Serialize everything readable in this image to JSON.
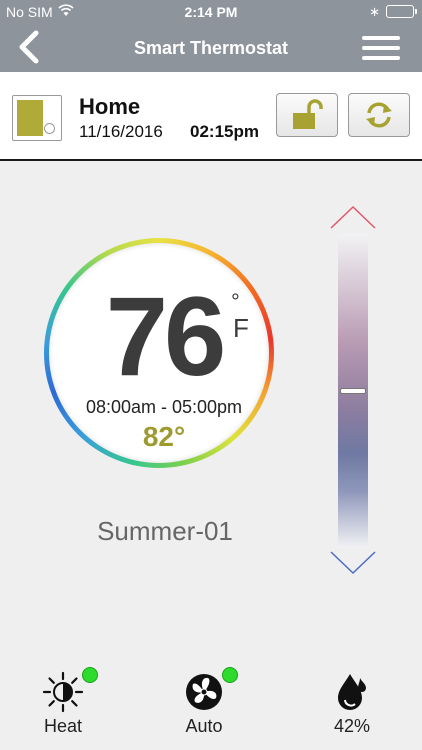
{
  "status_bar": {
    "carrier": "No SIM",
    "time": "2:14 PM"
  },
  "nav": {
    "title": "Smart Thermostat"
  },
  "header": {
    "location": "Home",
    "date": "11/16/2016",
    "time": "02:15pm"
  },
  "dial": {
    "current_temp": "76",
    "degree_symbol": "°",
    "unit": "F",
    "schedule": "08:00am - 05:00pm",
    "setpoint": "82°"
  },
  "profile": "Summer-01",
  "slider": {
    "level": 0.5
  },
  "bottom": {
    "mode": {
      "label": "Heat",
      "active": true
    },
    "fan": {
      "label": "Auto",
      "active": true
    },
    "humidity": {
      "label": "42%"
    }
  },
  "colors": {
    "accent": "#9e9a30",
    "indicator": "#2ddb2d",
    "nav_bg": "#8e949c"
  }
}
